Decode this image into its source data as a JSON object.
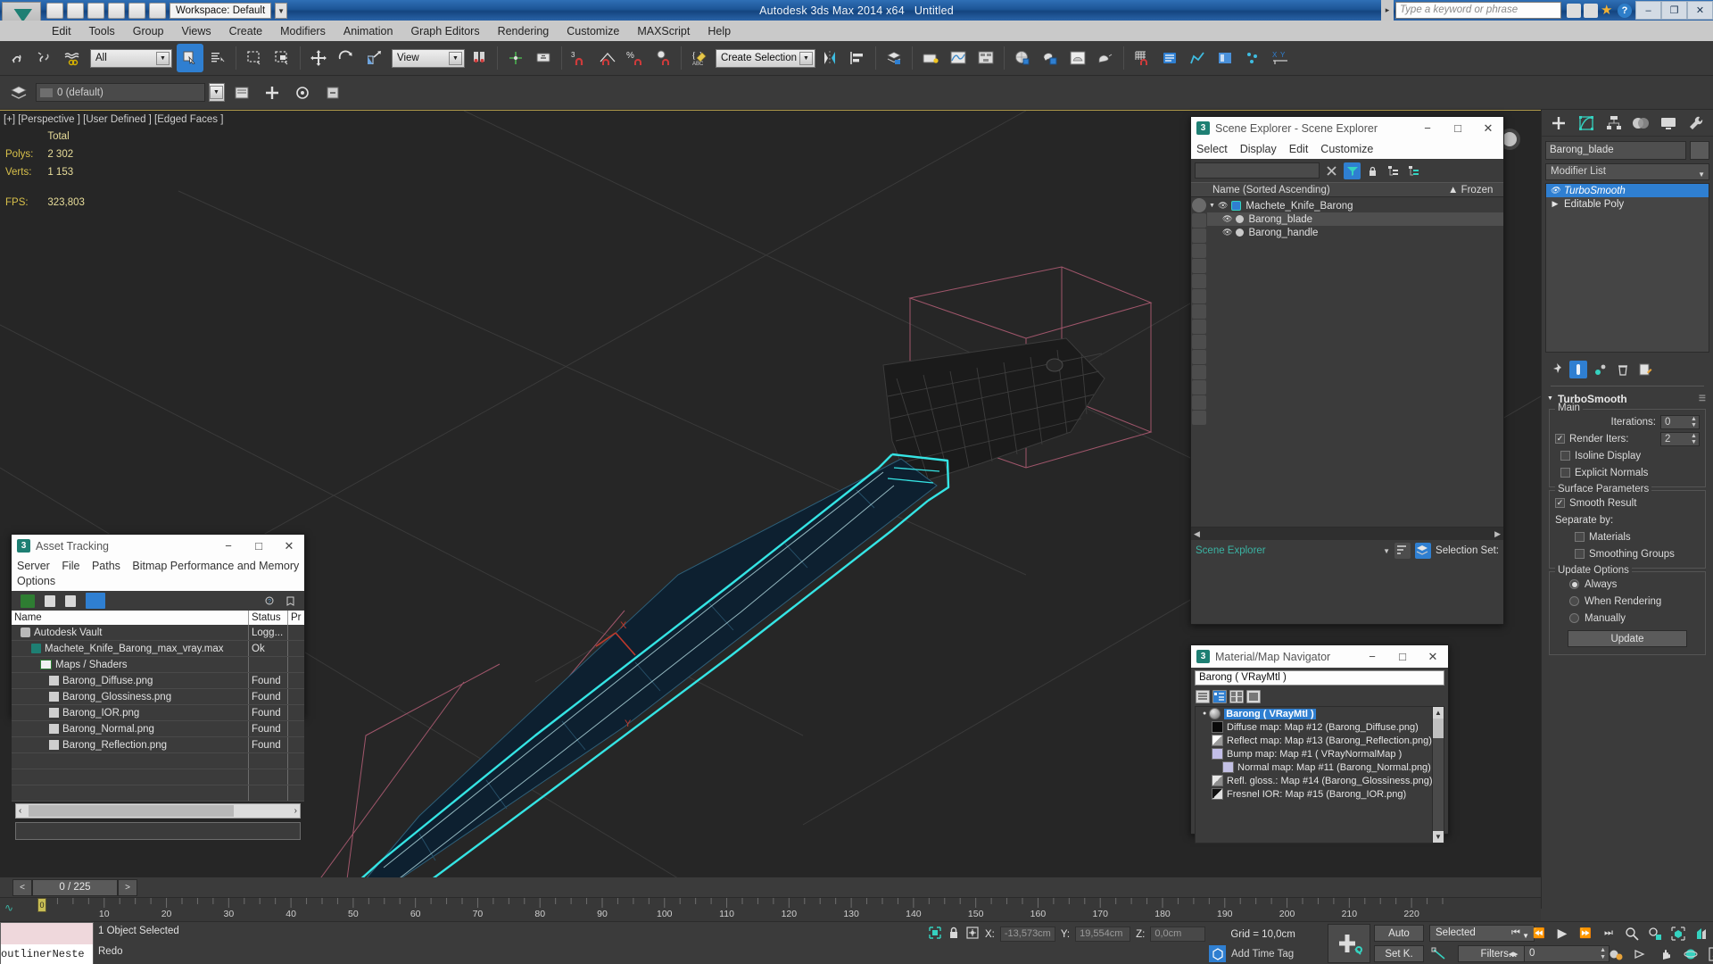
{
  "titlebar": {
    "app_title": "Autodesk 3ds Max  2014 x64",
    "document": "Untitled",
    "search_placeholder": "Type a keyword or phrase",
    "workspace": "Workspace: Default",
    "window_buttons": [
      "–",
      "❐",
      "✕"
    ]
  },
  "menubar": {
    "items": [
      "Edit",
      "Tools",
      "Group",
      "Views",
      "Create",
      "Modifiers",
      "Animation",
      "Graph Editors",
      "Rendering",
      "Customize",
      "MAXScript",
      "Help"
    ]
  },
  "toolbar": {
    "selection_filter": "All",
    "reference_coord": "View",
    "named_selection_set": "Create Selection Se",
    "layer_field": "0 (default)"
  },
  "viewport": {
    "label": "[+] [Perspective ] [User Defined ] [Edged Faces ]",
    "stats_header": "Total",
    "stats": [
      {
        "label": "Polys:",
        "value": "2 302"
      },
      {
        "label": "Verts:",
        "value": "1 153"
      },
      {
        "label": "FPS:",
        "value": "323,803"
      }
    ]
  },
  "scene_explorer": {
    "title": "Scene Explorer - Scene Explorer",
    "menus": [
      "Select",
      "Display",
      "Edit",
      "Customize"
    ],
    "columns": [
      "Name (Sorted Ascending)",
      "Frozen"
    ],
    "rows": [
      {
        "name": "Machete_Knife_Barong",
        "level": 0,
        "selected": false
      },
      {
        "name": "Barong_blade",
        "level": 1,
        "selected": true
      },
      {
        "name": "Barong_handle",
        "level": 1,
        "selected": false
      }
    ],
    "footer_name": "Scene Explorer",
    "footer_label": "Selection Set:"
  },
  "asset_tracking": {
    "title": "Asset Tracking",
    "menus": [
      "Server",
      "File",
      "Paths",
      "Bitmap Performance and Memory",
      "Options"
    ],
    "columns": [
      "Name",
      "Status",
      "Pr"
    ],
    "rows": [
      {
        "name": "Autodesk Vault",
        "status": "Logg...",
        "indent": 1,
        "icon": "vault-icon"
      },
      {
        "name": "Machete_Knife_Barong_max_vray.max",
        "status": "Ok",
        "indent": 2,
        "icon": "max-file-icon"
      },
      {
        "name": "Maps / Shaders",
        "status": "",
        "indent": 3,
        "icon": "folder-icon"
      },
      {
        "name": "Barong_Diffuse.png",
        "status": "Found",
        "indent": 4,
        "icon": "bitmap-icon"
      },
      {
        "name": "Barong_Glossiness.png",
        "status": "Found",
        "indent": 4,
        "icon": "bitmap-icon"
      },
      {
        "name": "Barong_IOR.png",
        "status": "Found",
        "indent": 4,
        "icon": "bitmap-icon"
      },
      {
        "name": "Barong_Normal.png",
        "status": "Found",
        "indent": 4,
        "icon": "bitmap-icon"
      },
      {
        "name": "Barong_Reflection.png",
        "status": "Found",
        "indent": 4,
        "icon": "bitmap-icon"
      }
    ]
  },
  "material_navigator": {
    "title": "Material/Map Navigator",
    "current": "Barong  ( VRayMtl )",
    "rows": [
      {
        "label": "Barong  ( VRayMtl )",
        "indent": 0,
        "swatch": "#9a9a9a",
        "root": true
      },
      {
        "label": "Diffuse map: Map #12 (Barong_Diffuse.png)",
        "indent": 1,
        "swatch": "#0a0a0a"
      },
      {
        "label": "Reflect map: Map #13 (Barong_Reflection.png)",
        "indent": 1,
        "swatch": "#e8e8e8"
      },
      {
        "label": "Bump map: Map #1  ( VRayNormalMap )",
        "indent": 1,
        "swatch": "#c3bfe8"
      },
      {
        "label": "Normal map: Map #11 (Barong_Normal.png)",
        "indent": 2,
        "swatch": "#c3c0e4"
      },
      {
        "label": "Refl. gloss.: Map #14 (Barong_Glossiness.png)",
        "indent": 1,
        "swatch": "#cfcfcf"
      },
      {
        "label": "Fresnel IOR: Map #15 (Barong_IOR.png)",
        "indent": 1,
        "swatch": "#101010"
      }
    ]
  },
  "command_panel": {
    "object_name": "Barong_blade",
    "modifier_list_label": "Modifier List",
    "stack": [
      {
        "label": "TurboSmooth",
        "selected": true
      },
      {
        "label": "Editable Poly",
        "selected": false
      }
    ],
    "rollout_title": "TurboSmooth",
    "groups": {
      "main": {
        "label": "Main",
        "iterations_label": "Iterations:",
        "iterations_value": "0",
        "render_iters_label": "Render Iters:",
        "render_iters_value": "2",
        "render_iters_checked": true,
        "isoline_label": "Isoline Display",
        "isoline_checked": false,
        "explicit_label": "Explicit Normals",
        "explicit_checked": false
      },
      "surface": {
        "label": "Surface Parameters",
        "smooth_result_label": "Smooth Result",
        "smooth_result_checked": true,
        "separate_by_label": "Separate by:",
        "materials_label": "Materials",
        "materials_checked": false,
        "smoothing_groups_label": "Smoothing Groups",
        "smoothing_groups_checked": false
      },
      "update": {
        "label": "Update Options",
        "options": [
          "Always",
          "When Rendering",
          "Manually"
        ],
        "selected": "Always",
        "button": "Update"
      }
    }
  },
  "timeline": {
    "frame_readout": "0 / 225",
    "prev_label": "<",
    "next_label": ">",
    "ticks": [
      0,
      10,
      20,
      30,
      40,
      50,
      60,
      70,
      80,
      90,
      100,
      110,
      120,
      130,
      140,
      150,
      160,
      170,
      180,
      190,
      200,
      210,
      220
    ],
    "playhead_label": "0"
  },
  "statusbar": {
    "listener_text": "outlinerNeste",
    "status_line": "1 Object Selected",
    "prompt_line": "Redo",
    "coords": [
      {
        "axis": "X:",
        "value": "-13,573cm"
      },
      {
        "axis": "Y:",
        "value": "19,554cm"
      },
      {
        "axis": "Z:",
        "value": "0,0cm"
      }
    ],
    "grid": "Grid = 10,0cm",
    "add_time_tag": "Add Time Tag",
    "auto_key": "Auto",
    "set_key": "Set K.",
    "key_filter": "Selected",
    "filters": "Filters...",
    "key_spinner": "0"
  },
  "colors": {
    "accent_blue": "#2f7fd1",
    "selection_cyan": "#35e4e4",
    "stats_yellow": "#d8c04a",
    "teal": "#3bb3a3"
  }
}
